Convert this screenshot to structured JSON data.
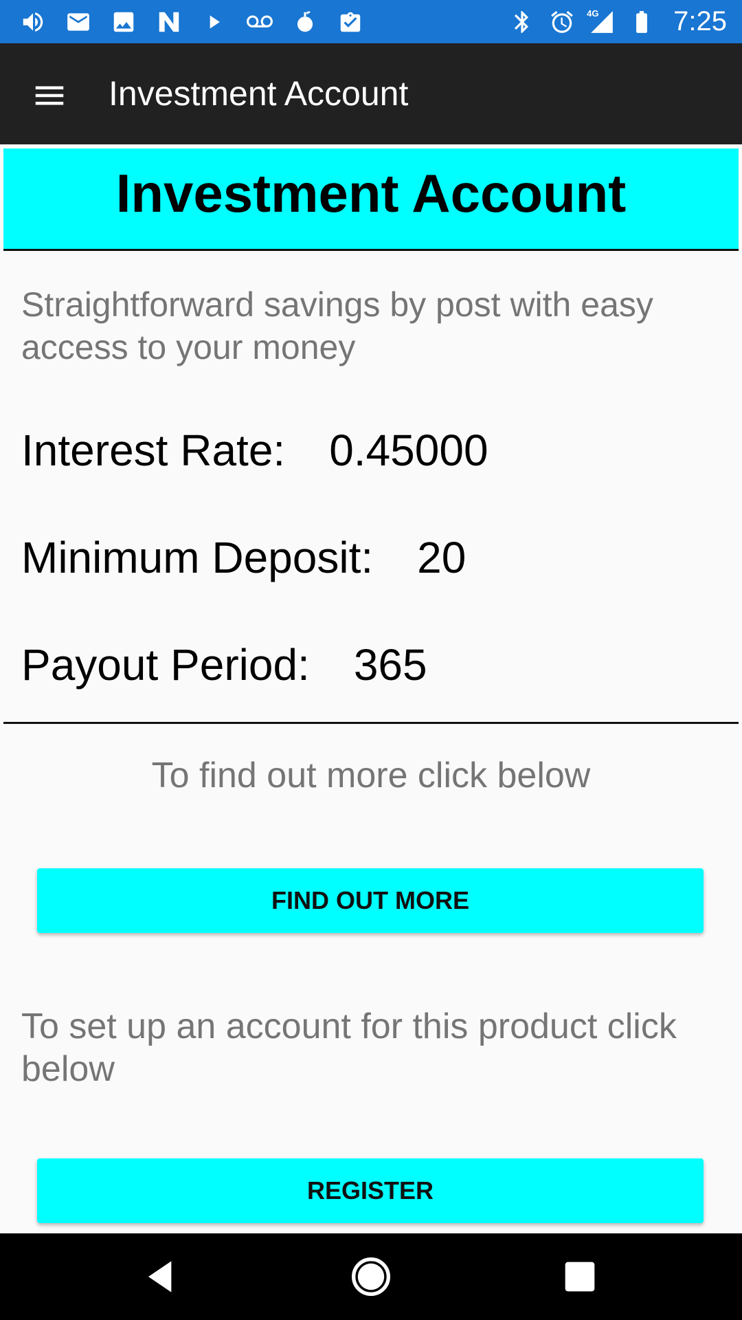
{
  "status_bar": {
    "left_icons": [
      "volume-icon",
      "mail-icon",
      "image-icon",
      "n-app-icon",
      "play-icon",
      "voicemail-icon",
      "bomb-icon",
      "clipboard-check-icon"
    ],
    "right_icons": [
      "bluetooth-icon",
      "alarm-icon",
      "signal-4g-icon",
      "battery-icon"
    ],
    "network": "4G",
    "time": "7:25",
    "background_color": "#1976d2"
  },
  "app_bar": {
    "title": "Investment Account",
    "menu_icon": "menu-icon",
    "background_color": "#212121"
  },
  "banner": {
    "title": "Investment Account",
    "background_color": "#00ffff"
  },
  "description": "Straightforward savings by post with easy access to your money",
  "details": {
    "interest_rate_label": "Interest Rate:",
    "interest_rate_value": "0.45000",
    "minimum_deposit_label": "Minimum Deposit:",
    "minimum_deposit_value": "20",
    "payout_period_label": "Payout Period:",
    "payout_period_value": "365"
  },
  "find_out_more": {
    "prompt": "To find out more click below",
    "button_label": "FIND OUT MORE"
  },
  "register": {
    "prompt": "To set up an account for this product click below",
    "button_label": "REGISTER"
  },
  "nav_bar": {
    "buttons": [
      "back-icon",
      "home-icon",
      "recents-icon"
    ]
  },
  "accent_color": "#00ffff"
}
